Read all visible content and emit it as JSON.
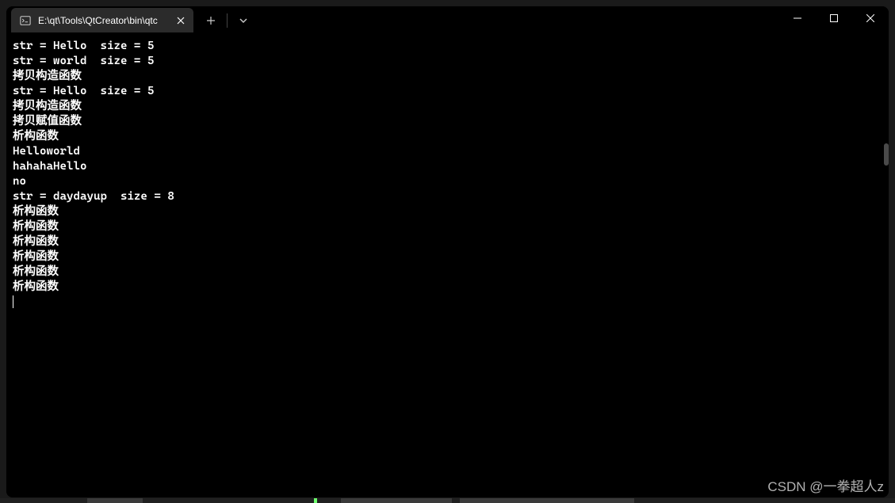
{
  "tab": {
    "title": "E:\\qt\\Tools\\QtCreator\\bin\\qtc"
  },
  "terminal": {
    "lines": [
      "str = Hello  size = 5",
      "str = world  size = 5",
      "拷贝构造函数",
      "str = Hello  size = 5",
      "拷贝构造函数",
      "拷贝赋值函数",
      "析构函数",
      "Helloworld",
      "hahahaHello",
      "no",
      "str = daydayup  size = 8",
      "析构函数",
      "析构函数",
      "析构函数",
      "析构函数",
      "析构函数",
      "析构函数"
    ]
  },
  "watermark": "CSDN @一拳超人z"
}
